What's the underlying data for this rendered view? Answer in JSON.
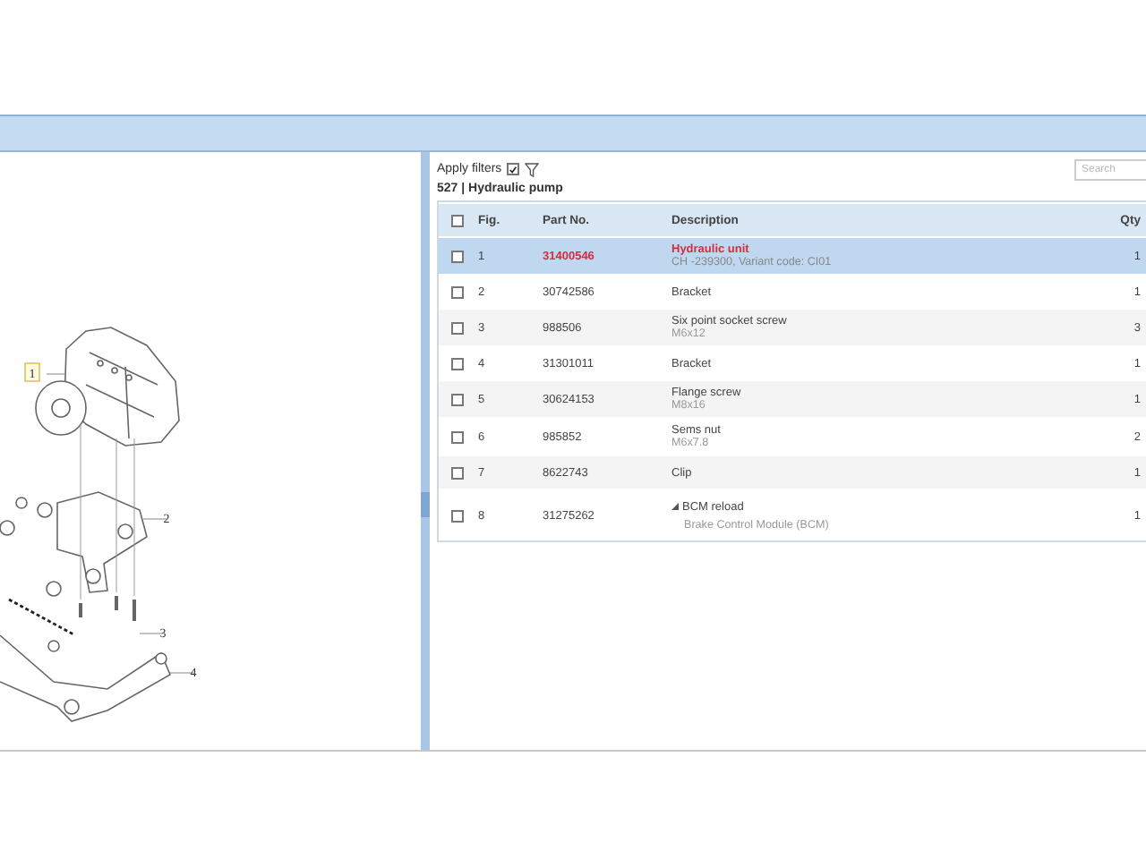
{
  "filters": {
    "label": "Apply filters",
    "checked": true
  },
  "search": {
    "placeholder": "Search"
  },
  "group_title": "527 | Hydraulic pump",
  "callouts": [
    {
      "label": "1",
      "selected": true
    },
    {
      "label": "2",
      "selected": false
    },
    {
      "label": "3",
      "selected": false
    },
    {
      "label": "4",
      "selected": false
    }
  ],
  "table": {
    "select_all_checked": false,
    "columns": [
      "Fig.",
      "Part No.",
      "Description",
      "Qty"
    ],
    "rows": [
      {
        "fig": "1",
        "part_no": "31400546",
        "description": "Hydraulic unit",
        "detail": "CH -239300, Variant code: CI01",
        "qty": "1",
        "selected": true,
        "checked": false,
        "kind": "part"
      },
      {
        "fig": "2",
        "part_no": "30742586",
        "description": "Bracket",
        "qty": "1",
        "selected": false,
        "checked": false,
        "kind": "part"
      },
      {
        "fig": "3",
        "part_no": "988506",
        "description": "Six point socket screw",
        "detail": "M6x12",
        "qty": "3",
        "selected": false,
        "checked": false,
        "kind": "part"
      },
      {
        "fig": "4",
        "part_no": "31301011",
        "description": "Bracket",
        "qty": "1",
        "selected": false,
        "checked": false,
        "kind": "part"
      },
      {
        "fig": "5",
        "part_no": "30624153",
        "description": "Flange screw",
        "detail": "M8x16",
        "qty": "1",
        "selected": false,
        "checked": false,
        "kind": "part"
      },
      {
        "fig": "6",
        "part_no": "985852",
        "description": "Sems nut",
        "detail": "M6x7.8",
        "qty": "2",
        "selected": false,
        "checked": false,
        "kind": "part"
      },
      {
        "fig": "7",
        "part_no": "8622743",
        "description": "Clip",
        "qty": "1",
        "selected": false,
        "checked": false,
        "kind": "part"
      },
      {
        "fig": "8",
        "part_no": "31275262",
        "description": "BCM reload",
        "detail": "Brake Control Module (BCM)",
        "qty": "1",
        "selected": false,
        "checked": false,
        "kind": "group"
      }
    ]
  }
}
